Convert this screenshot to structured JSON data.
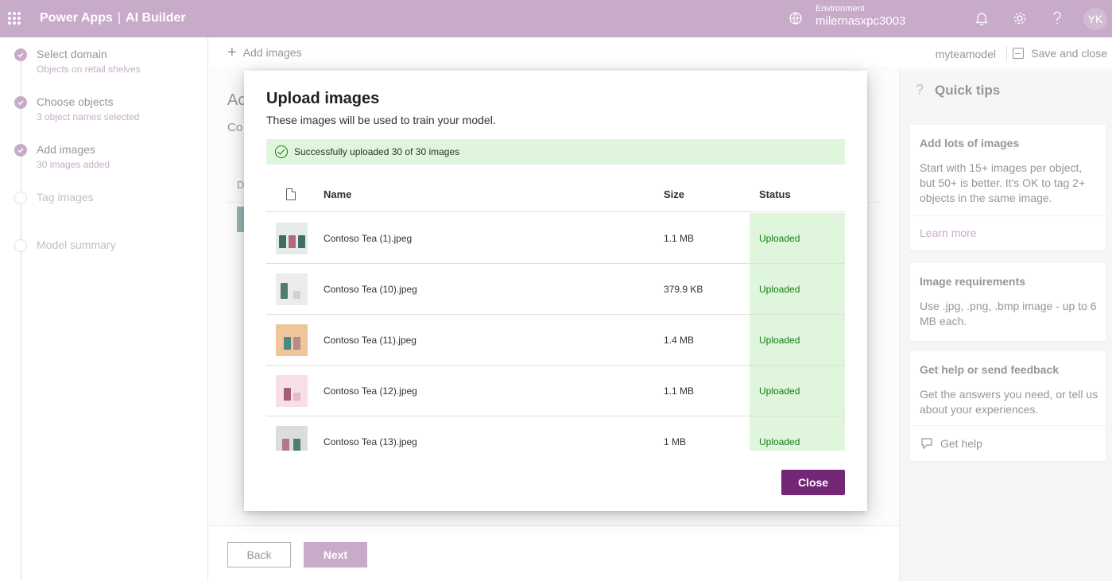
{
  "header": {
    "app": "Power Apps",
    "separator": "|",
    "product": "AI Builder",
    "environment_label": "Environment",
    "environment_name": "milernasxpc3003",
    "avatar_initials": "YK",
    "color": "#a97eac",
    "icons": [
      "waffle-icon",
      "environment-icon",
      "bell-icon",
      "gear-icon",
      "help-icon"
    ]
  },
  "steps": [
    {
      "title": "Select domain",
      "sub": "Objects on retail shelves",
      "done": true
    },
    {
      "title": "Choose objects",
      "sub": "3 object names selected",
      "done": true
    },
    {
      "title": "Add images",
      "sub": "30 images added",
      "done": true
    },
    {
      "title": "Tag images",
      "sub": "",
      "done": false
    },
    {
      "title": "Model summary",
      "sub": "",
      "done": false
    }
  ],
  "commandbar": {
    "add_images": "Add images",
    "model_name": "myteamodel",
    "save_close": "Save and close"
  },
  "main": {
    "title_partial": "Ac",
    "sub_partial": "Co",
    "col_partial": "D",
    "back": "Back",
    "next": "Next"
  },
  "tips": {
    "title": "Quick tips",
    "cards": [
      {
        "title": "Add lots of images",
        "body": "Start with 15+ images per object, but 50+ is better. It's OK to tag 2+ objects in the same image.",
        "link": "Learn more"
      },
      {
        "title": "Image requirements",
        "body": "Use .jpg, .png, .bmp image - up to 6 MB each."
      },
      {
        "title": "Get help or send feedback",
        "body": "Get the answers you need, or tell us about your experiences.",
        "link": "Get help"
      }
    ]
  },
  "dialog": {
    "title": "Upload images",
    "subtitle": "These images will be used to train your model.",
    "success": "Successfully uploaded 30 of 30 images",
    "columns": {
      "name": "Name",
      "size": "Size",
      "status": "Status"
    },
    "rows": [
      {
        "name": "Contoso Tea (1).jpeg",
        "size": "1.1 MB",
        "status": "Uploaded",
        "bg": "#e5ece7",
        "cans": [
          "#3f6f63",
          "#b06a7a",
          "#3f6f63"
        ]
      },
      {
        "name": "Contoso Tea (10).jpeg",
        "size": "379.9 KB",
        "status": "Uploaded",
        "bg": "#ececea",
        "cans": [
          "#4f7d70",
          "#cfd3cf"
        ]
      },
      {
        "name": "Contoso Tea (11).jpeg",
        "size": "1.4 MB",
        "status": "Uploaded",
        "bg": "#efc59a",
        "cans": [
          "#4a8a83",
          "#b88a8e"
        ]
      },
      {
        "name": "Contoso Tea (12).jpeg",
        "size": "1.1 MB",
        "status": "Uploaded",
        "bg": "#f6dfe6",
        "cans": [
          "#a35f74",
          "#e9b8c6"
        ]
      },
      {
        "name": "Contoso Tea (13).jpeg",
        "size": "1 MB",
        "status": "Uploaded",
        "bg": "#dcdcde",
        "cans": [
          "#b07a86",
          "#4f7d70"
        ]
      }
    ],
    "close": "Close",
    "status_color": "#107c10",
    "status_bg": "#dff6dd",
    "close_color": "#742774"
  }
}
